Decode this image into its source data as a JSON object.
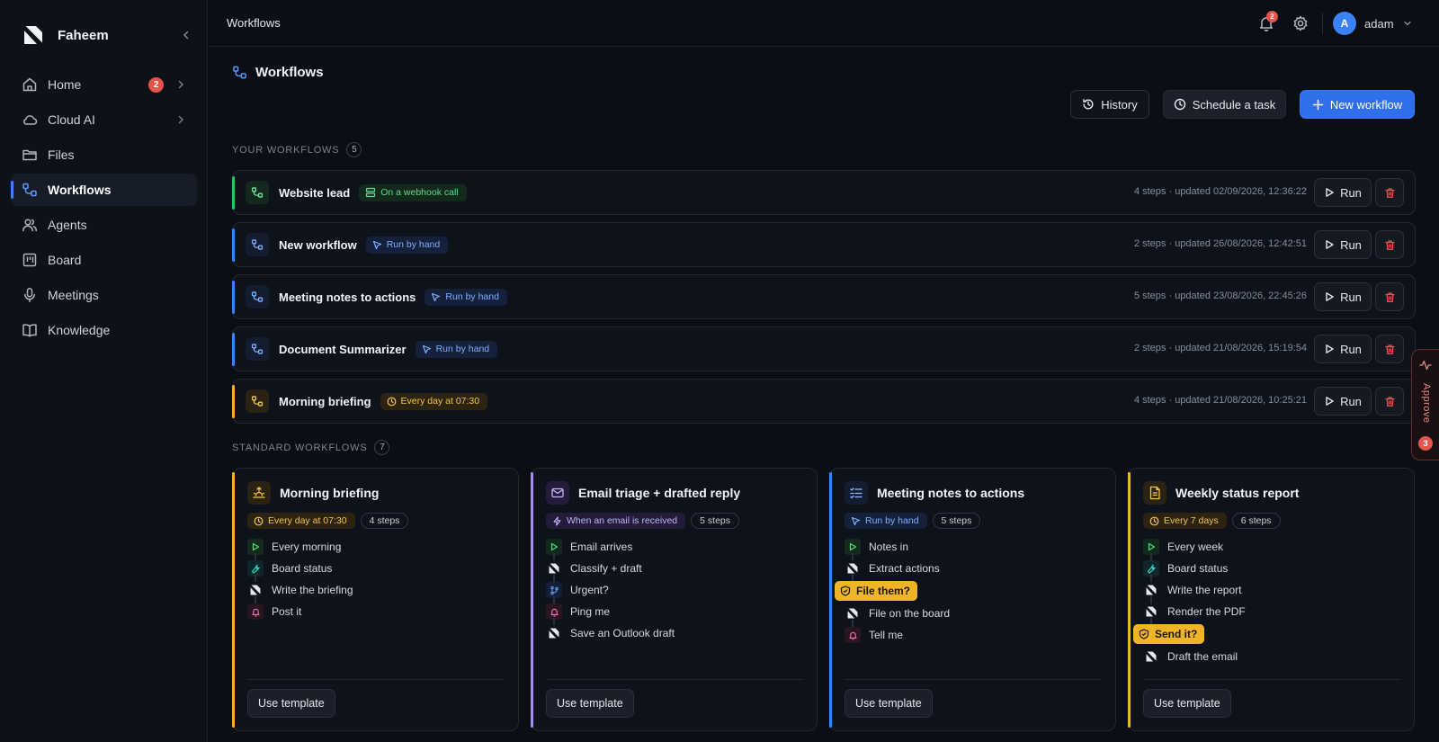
{
  "app": {
    "name": "Faheem"
  },
  "sidebar": {
    "items": [
      {
        "label": "Home",
        "icon": "home-icon",
        "badge": "2",
        "has_chevron": true
      },
      {
        "label": "Cloud AI",
        "icon": "cloud-icon",
        "has_chevron": true
      },
      {
        "label": "Files",
        "icon": "folder-icon"
      },
      {
        "label": "Workflows",
        "icon": "workflow-icon",
        "active": true
      },
      {
        "label": "Agents",
        "icon": "users-icon"
      },
      {
        "label": "Board",
        "icon": "board-icon"
      },
      {
        "label": "Meetings",
        "icon": "microphone-icon"
      },
      {
        "label": "Knowledge",
        "icon": "book-icon"
      }
    ]
  },
  "topbar": {
    "title": "Workflows",
    "notifications_count": "2",
    "user": {
      "initial": "A",
      "name": "adam"
    }
  },
  "page": {
    "title": "Workflows",
    "actions": {
      "history": "History",
      "schedule": "Schedule a task",
      "new_workflow": "New workflow"
    }
  },
  "your_workflows": {
    "label": "YOUR WORKFLOWS",
    "count": "5",
    "items": [
      {
        "name": "Website lead",
        "trigger": "On a webhook call",
        "trigger_type": "webhook",
        "meta": "4 steps · updated 02/09/2026, 12:36:22",
        "accent": "#22c55e"
      },
      {
        "name": "New workflow",
        "trigger": "Run by hand",
        "trigger_type": "manual",
        "meta": "2 steps · updated 26/08/2026, 12:42:51",
        "accent": "#3b82f6"
      },
      {
        "name": "Meeting notes to actions",
        "trigger": "Run by hand",
        "trigger_type": "manual",
        "meta": "5 steps · updated 23/08/2026, 22:45:26",
        "accent": "#3b82f6"
      },
      {
        "name": "Document Summarizer",
        "trigger": "Run by hand",
        "trigger_type": "manual",
        "meta": "2 steps · updated 21/08/2026, 15:19:54",
        "accent": "#3b82f6"
      },
      {
        "name": "Morning briefing",
        "trigger": "Every day at 07:30",
        "trigger_type": "schedule",
        "meta": "4 steps · updated 21/08/2026, 10:25:21",
        "accent": "#f0b429"
      }
    ],
    "run_label": "Run"
  },
  "standard_workflows": {
    "label": "STANDARD WORKFLOWS",
    "count": "7",
    "use_label": "Use template",
    "cards": [
      {
        "title": "Morning briefing",
        "icon": "sunrise-icon",
        "accent": "#f0b429",
        "trigger": "Every day at 07:30",
        "trigger_type": "schedule",
        "steps_label": "4 steps",
        "steps": [
          {
            "text": "Every morning",
            "kind": "start"
          },
          {
            "text": "Board status",
            "kind": "tool"
          },
          {
            "text": "Write the briefing",
            "kind": "ai"
          },
          {
            "text": "Post it",
            "kind": "notify"
          }
        ]
      },
      {
        "title": "Email triage + drafted reply",
        "icon": "mail-icon",
        "accent": "#a78bfa",
        "trigger": "When an email is received",
        "trigger_type": "event",
        "steps_label": "5 steps",
        "steps": [
          {
            "text": "Email arrives",
            "kind": "start"
          },
          {
            "text": "Classify + draft",
            "kind": "ai"
          },
          {
            "text": "Urgent?",
            "kind": "branch"
          },
          {
            "text": "Ping me",
            "kind": "notify"
          },
          {
            "text": "Save an Outlook draft",
            "kind": "ai"
          }
        ]
      },
      {
        "title": "Meeting notes to actions",
        "icon": "checklist-icon",
        "accent": "#3b82f6",
        "trigger": "Run by hand",
        "trigger_type": "manual",
        "steps_label": "5 steps",
        "steps": [
          {
            "text": "Notes in",
            "kind": "start"
          },
          {
            "text": "Extract actions",
            "kind": "ai"
          },
          {
            "text": "File them?",
            "kind": "gate"
          },
          {
            "text": "File on the board",
            "kind": "ai"
          },
          {
            "text": "Tell me",
            "kind": "notify"
          }
        ]
      },
      {
        "title": "Weekly status report",
        "icon": "document-icon",
        "accent": "#f0b429",
        "trigger": "Every 7 days",
        "trigger_type": "schedule",
        "steps_label": "6 steps",
        "steps": [
          {
            "text": "Every week",
            "kind": "start"
          },
          {
            "text": "Board status",
            "kind": "tool"
          },
          {
            "text": "Write the report",
            "kind": "ai"
          },
          {
            "text": "Render the PDF",
            "kind": "ai"
          },
          {
            "text": "Send it?",
            "kind": "gate"
          },
          {
            "text": "Draft the email",
            "kind": "ai"
          }
        ]
      }
    ]
  },
  "approve": {
    "label": "Approve",
    "count": "3"
  }
}
